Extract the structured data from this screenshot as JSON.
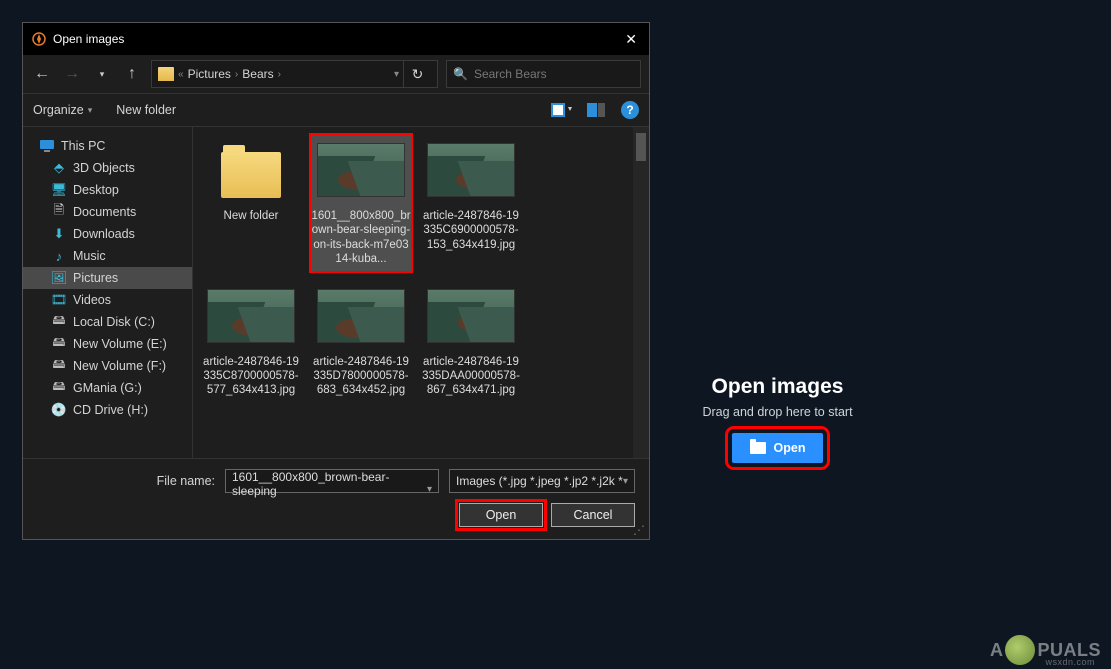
{
  "dialog": {
    "title": "Open images",
    "nav": {
      "breadcrumb": [
        "Pictures",
        "Bears"
      ],
      "search_placeholder": "Search Bears"
    },
    "toolbar": {
      "organize": "Organize",
      "new_folder": "New folder",
      "help_glyph": "?"
    },
    "sidebar": {
      "root": "This PC",
      "items": [
        {
          "icon": "cube",
          "label": "3D Objects"
        },
        {
          "icon": "desktop",
          "label": "Desktop"
        },
        {
          "icon": "doc",
          "label": "Documents"
        },
        {
          "icon": "download",
          "label": "Downloads"
        },
        {
          "icon": "music",
          "label": "Music"
        },
        {
          "icon": "picture",
          "label": "Pictures",
          "selected": true
        },
        {
          "icon": "video",
          "label": "Videos"
        },
        {
          "icon": "disk",
          "label": "Local Disk (C:)"
        },
        {
          "icon": "disk",
          "label": "New Volume (E:)"
        },
        {
          "icon": "disk",
          "label": "New Volume (F:)"
        },
        {
          "icon": "disk",
          "label": "GMania (G:)"
        },
        {
          "icon": "cd",
          "label": "CD Drive (H:)"
        }
      ]
    },
    "files": [
      {
        "kind": "folder",
        "label": "New folder"
      },
      {
        "kind": "image",
        "label": "1601__800x800_brown-bear-sleeping-on-its-back-m7e0314-kuba...",
        "selected": true,
        "highlight": true
      },
      {
        "kind": "image",
        "label": "article-2487846-19335C6900000578-153_634x419.jpg"
      },
      {
        "kind": "image",
        "label": "article-2487846-19335C8700000578-577_634x413.jpg"
      },
      {
        "kind": "image",
        "label": "article-2487846-19335D7800000578-683_634x452.jpg"
      },
      {
        "kind": "image",
        "label": "article-2487846-19335DAA00000578-867_634x471.jpg"
      }
    ],
    "footer": {
      "file_name_label": "File name:",
      "file_name_value": "1601__800x800_brown-bear-sleeping",
      "filter": "Images (*.jpg *.jpeg *.jp2 *.j2k *",
      "open": "Open",
      "cancel": "Cancel"
    }
  },
  "drop": {
    "title": "Open images",
    "subtitle": "Drag and drop here to start",
    "button": "Open"
  },
  "watermark": {
    "brand_a": "A",
    "brand_b": "PUALS",
    "url": "wsxdn.com"
  }
}
